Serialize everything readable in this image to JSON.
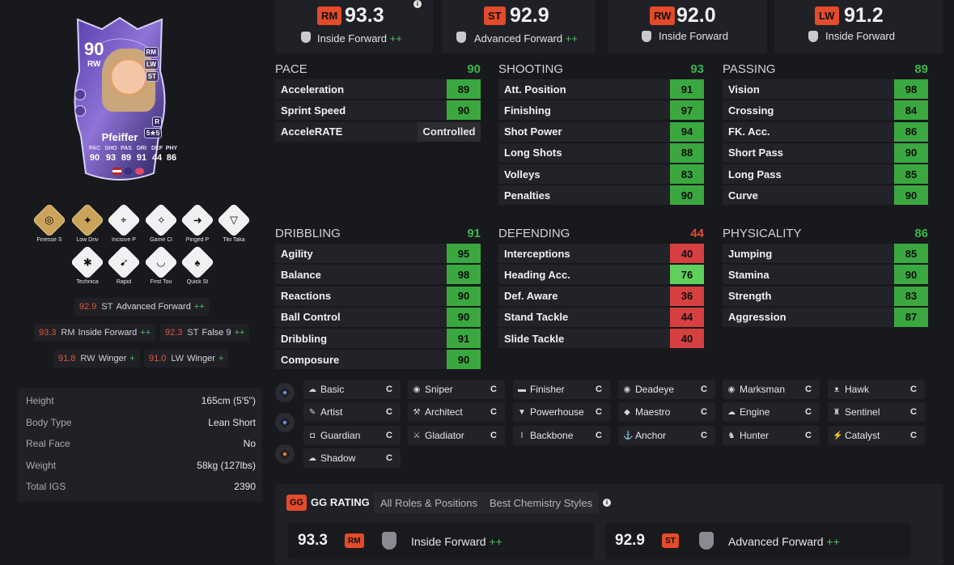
{
  "card": {
    "rating": "90",
    "position": "RW",
    "alt_positions": [
      "RM",
      "LW",
      "ST"
    ],
    "skill_foot": "R",
    "skill_weak": "5★5",
    "name": "Pfeiffer",
    "stat_labels": [
      "PAC",
      "SHO",
      "PAS",
      "DRI",
      "DEF",
      "PHY"
    ],
    "stat_values": [
      "90",
      "93",
      "89",
      "91",
      "44",
      "86"
    ]
  },
  "playstyles": [
    {
      "label": "Finesse S",
      "type": "gold",
      "icon": "finesse-shot-icon"
    },
    {
      "label": "Low Driv",
      "type": "gold",
      "icon": "low-driven-shot-icon"
    },
    {
      "label": "Incisive P",
      "type": "white",
      "icon": "incisive-pass-icon"
    },
    {
      "label": "Game Cl",
      "type": "white",
      "icon": "game-changer-icon"
    },
    {
      "label": "Pinged P",
      "type": "white",
      "icon": "pinged-pass-icon"
    },
    {
      "label": "Tiki Taka",
      "type": "white",
      "icon": "tiki-taka-icon"
    },
    {
      "label": "Technica",
      "type": "white",
      "icon": "technical-icon"
    },
    {
      "label": "Rapid",
      "type": "white",
      "icon": "rapid-icon"
    },
    {
      "label": "First Tou",
      "type": "white",
      "icon": "first-touch-icon"
    },
    {
      "label": "Quick St",
      "type": "white",
      "icon": "quick-step-icon"
    }
  ],
  "alt_roles": [
    {
      "rating": "92.9",
      "pos": "ST",
      "name": "Advanced Forward",
      "plus": "++"
    },
    {
      "rating": "93.3",
      "pos": "RM",
      "name": "Inside Forward",
      "plus": "++"
    },
    {
      "rating": "92.3",
      "pos": "ST",
      "name": "False 9",
      "plus": "++"
    },
    {
      "rating": "91.8",
      "pos": "RW",
      "name": "Winger",
      "plus": "+"
    },
    {
      "rating": "91.0",
      "pos": "LW",
      "name": "Winger",
      "plus": "+"
    }
  ],
  "info": [
    {
      "k": "Height",
      "v": "165cm (5'5\")"
    },
    {
      "k": "Body Type",
      "v": "Lean Short"
    },
    {
      "k": "Real Face",
      "v": "No"
    },
    {
      "k": "Weight",
      "v": "58kg (127lbs)"
    },
    {
      "k": "Total IGS",
      "v": "2390"
    }
  ],
  "top_roles": [
    {
      "pos": "RM",
      "value": "93.3",
      "role": "Inside Forward",
      "plus": "++"
    },
    {
      "pos": "ST",
      "value": "92.9",
      "role": "Advanced Forward",
      "plus": "++"
    },
    {
      "pos": "RW",
      "value": "92.0",
      "role": "Inside Forward",
      "plus": ""
    },
    {
      "pos": "LW",
      "value": "91.2",
      "role": "Inside Forward",
      "plus": ""
    }
  ],
  "top_info_icon": "i",
  "groups": [
    {
      "title": "PACE",
      "value": "90",
      "value_color": "#3ab54a",
      "rows": [
        {
          "name": "Acceleration",
          "value": "89",
          "color": "g"
        },
        {
          "name": "Sprint Speed",
          "value": "90",
          "color": "g"
        },
        {
          "name": "AcceleRATE",
          "value": "Controlled",
          "color": "ctl"
        }
      ]
    },
    {
      "title": "SHOOTING",
      "value": "93",
      "value_color": "#3ab54a",
      "rows": [
        {
          "name": "Att. Position",
          "value": "91",
          "color": "g"
        },
        {
          "name": "Finishing",
          "value": "97",
          "color": "g"
        },
        {
          "name": "Shot Power",
          "value": "94",
          "color": "g"
        },
        {
          "name": "Long Shots",
          "value": "88",
          "color": "g"
        },
        {
          "name": "Volleys",
          "value": "83",
          "color": "g"
        },
        {
          "name": "Penalties",
          "value": "90",
          "color": "g"
        }
      ]
    },
    {
      "title": "PASSING",
      "value": "89",
      "value_color": "#3ab54a",
      "rows": [
        {
          "name": "Vision",
          "value": "98",
          "color": "g"
        },
        {
          "name": "Crossing",
          "value": "84",
          "color": "g"
        },
        {
          "name": "FK. Acc.",
          "value": "86",
          "color": "g"
        },
        {
          "name": "Short Pass",
          "value": "90",
          "color": "g"
        },
        {
          "name": "Long Pass",
          "value": "85",
          "color": "g"
        },
        {
          "name": "Curve",
          "value": "90",
          "color": "g"
        }
      ]
    },
    {
      "title": "DRIBBLING",
      "value": "91",
      "value_color": "#3ab54a",
      "rows": [
        {
          "name": "Agility",
          "value": "95",
          "color": "g"
        },
        {
          "name": "Balance",
          "value": "98",
          "color": "g"
        },
        {
          "name": "Reactions",
          "value": "90",
          "color": "g"
        },
        {
          "name": "Ball Control",
          "value": "90",
          "color": "g"
        },
        {
          "name": "Dribbling",
          "value": "91",
          "color": "g"
        },
        {
          "name": "Composure",
          "value": "90",
          "color": "g"
        }
      ]
    },
    {
      "title": "DEFENDING",
      "value": "44",
      "value_color": "#e24b3b",
      "rows": [
        {
          "name": "Interceptions",
          "value": "40",
          "color": "rd"
        },
        {
          "name": "Heading Acc.",
          "value": "76",
          "color": "lg"
        },
        {
          "name": "Def. Aware",
          "value": "36",
          "color": "rd"
        },
        {
          "name": "Stand Tackle",
          "value": "44",
          "color": "rd"
        },
        {
          "name": "Slide Tackle",
          "value": "40",
          "color": "rd"
        }
      ]
    },
    {
      "title": "PHYSICALITY",
      "value": "86",
      "value_color": "#3ab54a",
      "rows": [
        {
          "name": "Jumping",
          "value": "85",
          "color": "g"
        },
        {
          "name": "Stamina",
          "value": "90",
          "color": "g"
        },
        {
          "name": "Strength",
          "value": "83",
          "color": "g"
        },
        {
          "name": "Aggression",
          "value": "87",
          "color": "g"
        }
      ]
    }
  ],
  "chem_rows": [
    [
      {
        "n": "Basic",
        "c": "C",
        "i": "basic-icon"
      },
      {
        "n": "Sniper",
        "c": "C",
        "i": "sniper-icon"
      },
      {
        "n": "Finisher",
        "c": "C",
        "i": "finisher-icon"
      },
      {
        "n": "Deadeye",
        "c": "C",
        "i": "deadeye-icon"
      },
      {
        "n": "Marksman",
        "c": "C",
        "i": "marksman-icon"
      },
      {
        "n": "Hawk",
        "c": "C",
        "i": "hawk-icon"
      }
    ],
    [
      {
        "n": "Artist",
        "c": "C",
        "i": "artist-icon"
      },
      {
        "n": "Architect",
        "c": "C",
        "i": "architect-icon"
      },
      {
        "n": "Powerhouse",
        "c": "C",
        "i": "powerhouse-icon"
      },
      {
        "n": "Maestro",
        "c": "C",
        "i": "maestro-icon"
      },
      {
        "n": "Engine",
        "c": "C",
        "i": "engine-icon"
      },
      {
        "n": "Sentinel",
        "c": "C",
        "i": "sentinel-icon"
      }
    ],
    [
      {
        "n": "Guardian",
        "c": "C",
        "i": "guardian-icon"
      },
      {
        "n": "Gladiator",
        "c": "C",
        "i": "gladiator-icon"
      },
      {
        "n": "Backbone",
        "c": "C",
        "i": "backbone-icon"
      },
      {
        "n": "Anchor",
        "c": "C",
        "i": "anchor-icon"
      },
      {
        "n": "Hunter",
        "c": "C",
        "i": "hunter-icon"
      },
      {
        "n": "Catalyst",
        "c": "C",
        "i": "catalyst-icon"
      }
    ],
    [
      {
        "n": "Shadow",
        "c": "C",
        "i": "shadow-icon"
      }
    ]
  ],
  "gg": {
    "badge": "GG",
    "title": "GG RATING",
    "tabs": [
      "All Roles & Positions",
      "Best Chemistry Styles"
    ],
    "info_icon": "i",
    "best": [
      {
        "value": "93.3",
        "pos": "RM",
        "role": "Inside Forward",
        "plus": "++"
      },
      {
        "value": "92.9",
        "pos": "ST",
        "role": "Advanced Forward",
        "plus": "++"
      }
    ]
  },
  "colors": {
    "accent": "#e24b2b",
    "green": "#3aa83f",
    "light_green": "#5fd05c",
    "red": "#d64040",
    "bg": "#18191d",
    "panel": "#202126"
  }
}
